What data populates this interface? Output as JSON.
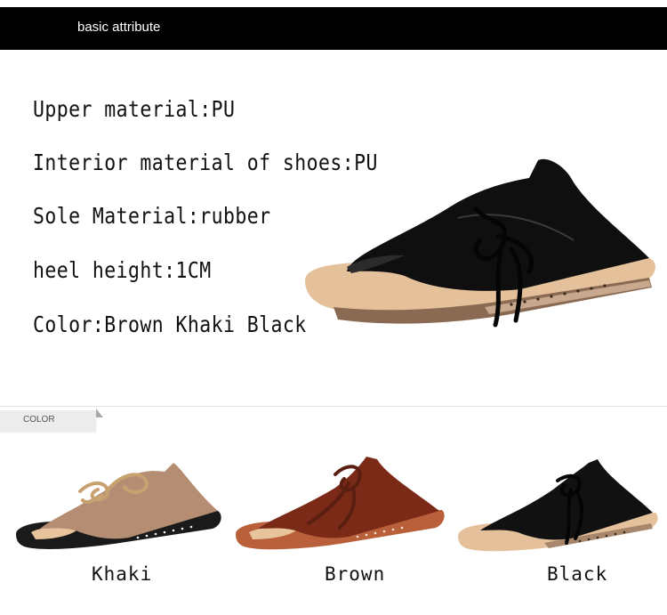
{
  "header": {
    "title": "basic attribute"
  },
  "specs": [
    "Upper material:PU",
    "Interior material of shoes:PU",
    "Sole Material:rubber",
    "heel height:1CM",
    "Color:Brown Khaki Black"
  ],
  "color_section": {
    "tab_label": "COLOR"
  },
  "variants": [
    {
      "label": "Khaki",
      "upper_color": "#b48d72",
      "sole_color": "#1a1a1a",
      "lace_color": "#c8a170"
    },
    {
      "label": "Brown",
      "upper_color": "#7a2a17",
      "sole_color": "#c56b45",
      "lace_color": "#6b2616"
    },
    {
      "label": "Black",
      "upper_color": "#111111",
      "sole_color": "#9a7a62",
      "lace_color": "#0d0d0d"
    }
  ],
  "colors": {
    "header_bg": "#000000",
    "footbed": "#e8c49d"
  }
}
